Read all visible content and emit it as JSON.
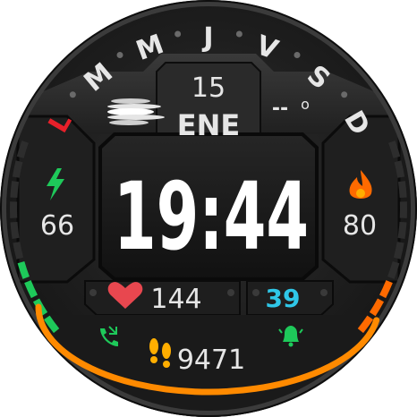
{
  "weekdays": [
    {
      "letter": "L",
      "color": "#e8202a"
    },
    {
      "letter": "M",
      "color": "#e6e6e6"
    },
    {
      "letter": "M",
      "color": "#e6e6e6"
    },
    {
      "letter": "J",
      "color": "#e6e6e6"
    },
    {
      "letter": "V",
      "color": "#e6e6e6"
    },
    {
      "letter": "S",
      "color": "#e6e6e6"
    },
    {
      "letter": "D",
      "color": "#e6e6e6"
    }
  ],
  "date": {
    "day": "15",
    "month": "ENE"
  },
  "weather": {
    "temp": "--",
    "unit": "o"
  },
  "time": "19:44",
  "battery": {
    "value": "66",
    "level": 0.35,
    "color": "#1ec95a",
    "icon": "lightning-icon"
  },
  "calories": {
    "value": "80",
    "level": 0.3,
    "color": "#ff6a00",
    "icon": "flame-icon"
  },
  "heart_rate": {
    "value": "144",
    "icon": "heart-icon",
    "color": "#e8474f"
  },
  "pai": {
    "value": "39",
    "color": "#2fc7e8"
  },
  "steps": {
    "value": "9471",
    "icon": "footprints-icon",
    "color": "#ffae00",
    "progress": 0.95,
    "arc_color": "#ff8a00"
  },
  "status_icons": {
    "phone": "phone-icon",
    "alarm": "alarm-bell-icon",
    "icon_color": "#1ec95a"
  }
}
